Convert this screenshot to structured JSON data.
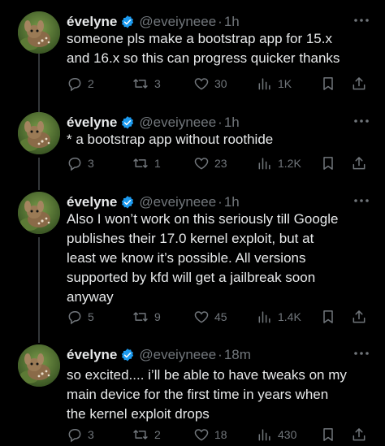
{
  "tweets": [
    {
      "display_name": "évelyne",
      "handle": "@eveiyneee",
      "separator": "·",
      "time": "1h",
      "lines": [
        "someone pls make a bootstrap app for 15.x",
        "and 16.x so this can progress quicker thanks"
      ],
      "replies": "2",
      "retweets": "3",
      "likes": "30",
      "views": "1K"
    },
    {
      "display_name": "évelyne",
      "handle": "@eveiyneee",
      "separator": "·",
      "time": "1h",
      "lines": [
        "* a bootstrap app without roothide"
      ],
      "replies": "3",
      "retweets": "1",
      "likes": "23",
      "views": "1.2K"
    },
    {
      "display_name": "évelyne",
      "handle": "@eveiyneee",
      "separator": "·",
      "time": "1h",
      "lines": [
        "Also I won’t work on this seriously till Google",
        "publishes their 17.0 kernel exploit, but at",
        "least we know it’s possible. All versions",
        "supported by kfd will get a jailbreak soon",
        "anyway"
      ],
      "replies": "5",
      "retweets": "9",
      "likes": "45",
      "views": "1.4K"
    },
    {
      "display_name": "évelyne",
      "handle": "@eveiyneee",
      "separator": "·",
      "time": "18m",
      "lines": [
        "so excited.... i’ll be able to have tweaks on my",
        "main device for the first time in years when",
        "the kernel exploit drops"
      ],
      "replies": "3",
      "retweets": "2",
      "likes": "18",
      "views": "430"
    }
  ],
  "icons": {
    "verified": "verified-badge-icon",
    "more": "more-dots-icon",
    "reply": "reply-icon",
    "retweet": "retweet-icon",
    "like": "heart-icon",
    "views": "views-icon",
    "bookmark": "bookmark-icon",
    "share": "share-icon"
  },
  "colors": {
    "background": "#000000",
    "text": "#e7e9ea",
    "muted": "#71767b",
    "verified": "#1d9bf0",
    "thread_line": "#333639"
  }
}
